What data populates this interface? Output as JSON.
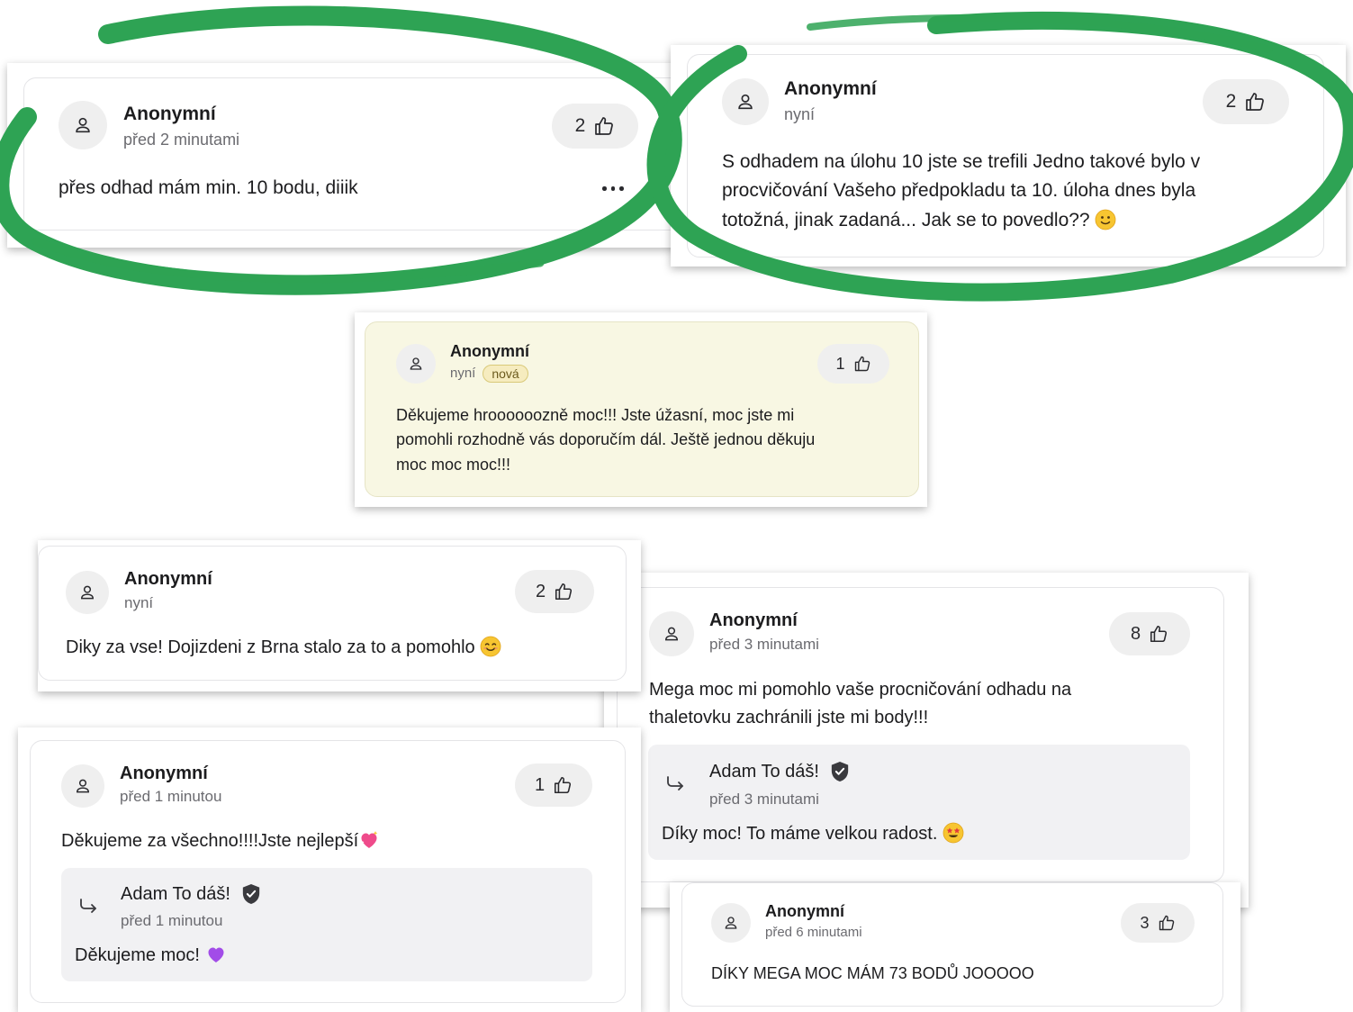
{
  "comments": [
    {
      "author": "Anonymní",
      "time": "před 2 minutami",
      "likes": "2",
      "text": "přes odhad mám min. 10 bodu, diiik",
      "highlighted": true
    },
    {
      "author": "Anonymní",
      "time": "nyní",
      "likes": "2",
      "text_line1": "S odhadem na úlohu 10 jste se trefili Jedno takové bylo v",
      "text_line2": "procvičování Vašeho předpokladu ta 10. úloha dnes byla",
      "text_line3": "totožná, jinak zadaná... Jak se to povedlo??",
      "emoji": "slightly-smiling-face",
      "highlighted": true
    },
    {
      "author": "Anonymní",
      "time": "nyní",
      "badge": "nová",
      "likes": "1",
      "text_line1": "Děkujeme hroooooozně moc!!! Jste úžasní, moc jste mi",
      "text_line2": "pomohli rozhodně vás doporučím dál. Ještě jednou děkuju",
      "text_line3": "moc moc moc!!!"
    },
    {
      "author": "Anonymní",
      "time": "nyní",
      "likes": "2",
      "text": "Diky za vse! Dojizdeni z Brna stalo za to a pomohlo",
      "emoji": "smiling-face"
    },
    {
      "author": "Anonymní",
      "time": "před 3 minutami",
      "likes": "8",
      "text_line1": "Mega moc mi pomohlo vaše procničování odhadu na",
      "text_line2": "thaletovku zachránili jste mi body!!!",
      "reply": {
        "author": "Adam To dáš!",
        "time": "před 3 minutami",
        "text": "Díky moc! To máme velkou radost.",
        "emoji": "star-struck"
      }
    },
    {
      "author": "Anonymní",
      "time": "před 1 minutou",
      "likes": "1",
      "text": "Děkujeme za všechno!!!!Jste nejlepší",
      "emoji": "sparkling-heart",
      "reply": {
        "author": "Adam To dáš!",
        "time": "před 1 minutou",
        "text": "Děkujeme moc!",
        "emoji": "purple-heart"
      }
    },
    {
      "author": "Anonymní",
      "time": "před 6 minutami",
      "likes": "3",
      "text": "DÍKY MEGA MOC MÁM 73 BODŮ JOOOOO"
    }
  ],
  "icons": {
    "avatar": "user-icon",
    "like": "thumbs-up-icon",
    "verified": "verified-shield-icon",
    "reply": "reply-arrow-icon",
    "more": "more-icon"
  },
  "colors": {
    "highlight_circle": "#2ea354",
    "new_comment_bg": "#f8f7e3",
    "reply_bg": "#f1f1f3"
  }
}
